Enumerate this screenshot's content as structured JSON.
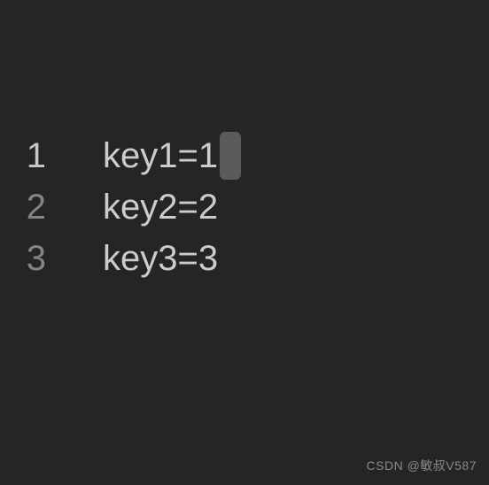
{
  "editor": {
    "lines": [
      {
        "number": "1",
        "text": "key1=1",
        "active": true,
        "cursor": true
      },
      {
        "number": "2",
        "text": "key2=2",
        "active": false,
        "cursor": false
      },
      {
        "number": "3",
        "text": "key3=3",
        "active": false,
        "cursor": false
      }
    ]
  },
  "watermark": "CSDN @敏叔V587"
}
